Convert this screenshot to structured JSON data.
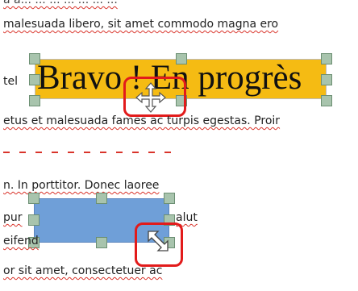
{
  "document": {
    "lines": [
      "a s...  malesuada libero, sit amet commodo magna ero",
      "malesuada libero, sit amet commodo magna ero",
      "tel",
      "etus et malesuada fames ac turpis egestas. Proir",
      "n. In porttitor. Donec laoree",
      "pur",
      "alut",
      "eifend",
      "or sit amet, consectetuer ac"
    ]
  },
  "wordart": {
    "text": "Bravo ! En progrès",
    "fill_color": "#f5bb13"
  },
  "shape": {
    "fill_color": "#6f9fd8"
  },
  "highlight_color": "#e21b1b",
  "icons": {
    "move_cursor": "move-cursor-icon",
    "resize_cursor": "resize-diagonal-cursor-icon"
  }
}
